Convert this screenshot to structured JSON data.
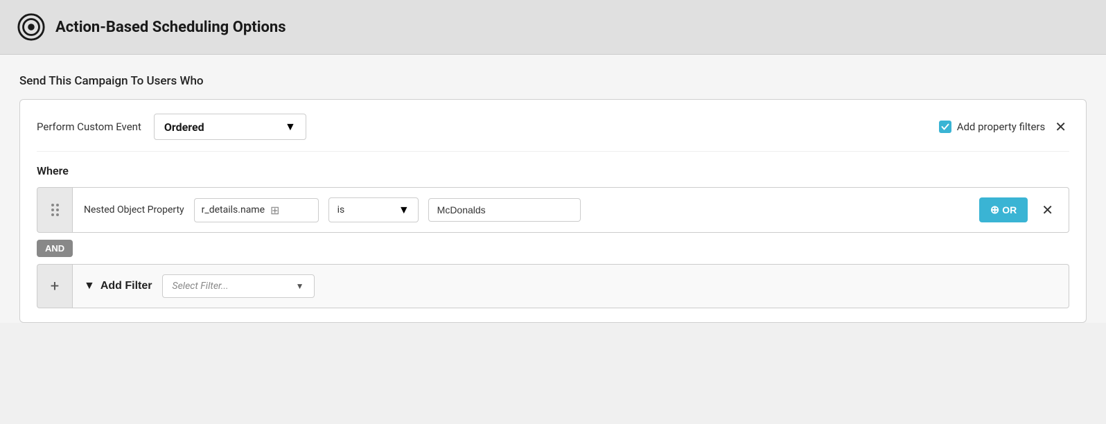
{
  "header": {
    "title": "Action-Based Scheduling Options"
  },
  "main": {
    "section_label": "Send This Campaign To Users Who",
    "event_row": {
      "label": "Perform Custom Event",
      "selected_event": "Ordered",
      "add_property_filters_label": "Add property filters",
      "close_label": "✕"
    },
    "where_section": {
      "label": "Where",
      "filter_row": {
        "drag_handle": "⠿",
        "filter_type": "Nested Object Property",
        "property_value": "r_details.name",
        "operator": "is",
        "input_value": "McDonalds",
        "or_label": "OR",
        "close_label": "✕"
      },
      "and_label": "AND",
      "add_filter_row": {
        "plus_label": "+",
        "add_filter_label": "Add Filter",
        "select_placeholder": "Select Filter..."
      }
    }
  }
}
